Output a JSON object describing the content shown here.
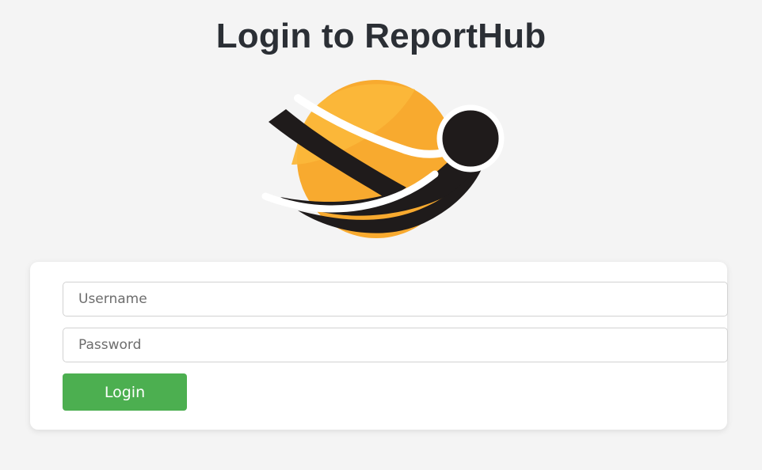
{
  "page": {
    "title": "Login to ReportHub"
  },
  "logo": {
    "icon": "reporthub-logo-icon",
    "colors": {
      "orange": "#f8aa2f",
      "dark": "#1f1b1b",
      "white": "#ffffff"
    }
  },
  "form": {
    "username": {
      "placeholder": "Username",
      "value": ""
    },
    "password": {
      "placeholder": "Password",
      "value": ""
    },
    "submit_label": "Login"
  },
  "colors": {
    "background": "#f4f4f4",
    "card": "#ffffff",
    "button": "#4caf50",
    "title": "#2b2f35"
  }
}
